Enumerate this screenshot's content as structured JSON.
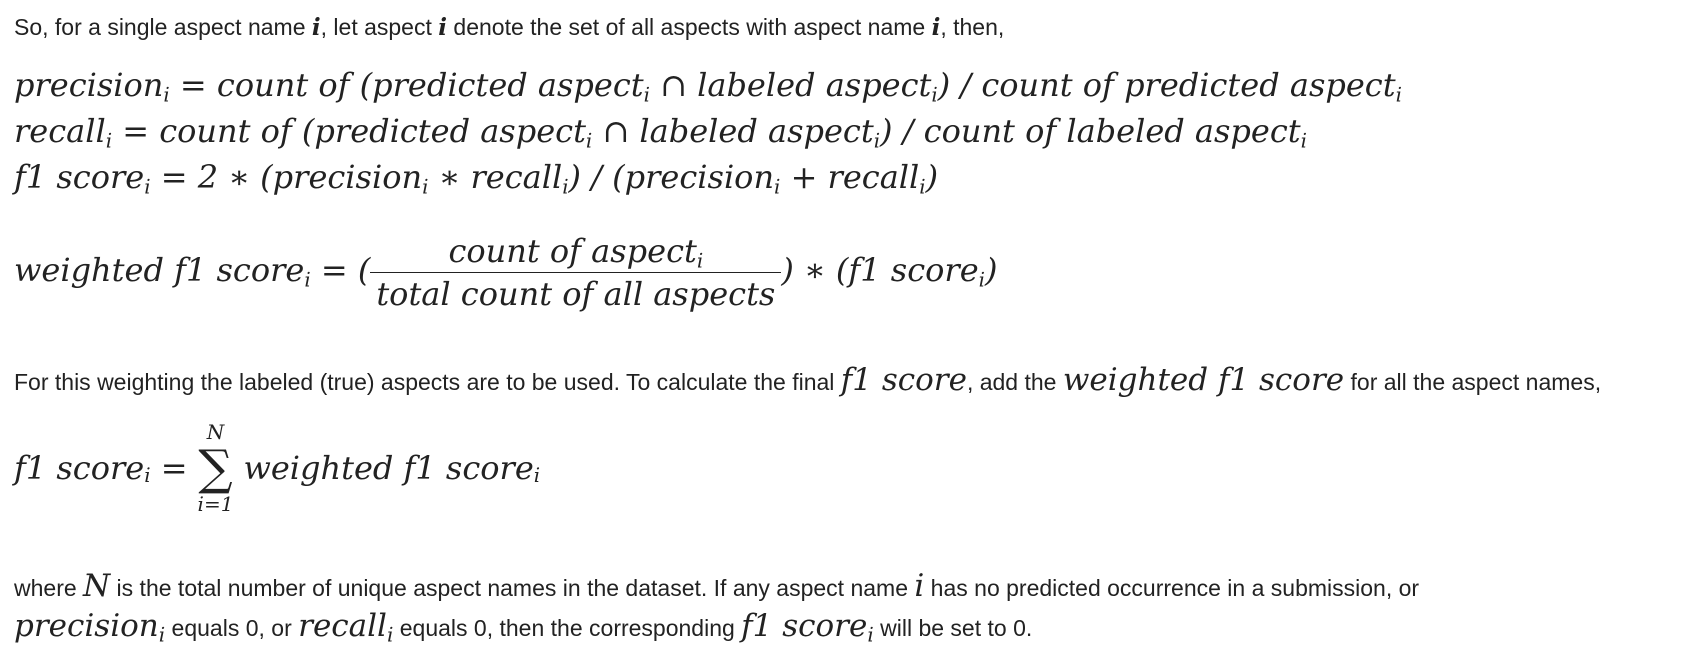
{
  "para1": {
    "a": "So, for a single aspect name ",
    "i1": "i",
    "b": ", let aspect ",
    "i2": "i",
    "c": " denote the set of all aspects with aspect name ",
    "i3": "i",
    "d": ", then,"
  },
  "eq_precision": {
    "lhs": "precision",
    "sub": "i",
    "rhs1": " = count of (predicted aspect",
    "rhs2": " ∩ labeled aspect",
    "rhs3": ") / count of predicted aspect"
  },
  "eq_recall": {
    "lhs": "recall",
    "sub": "i",
    "rhs1": " = count of (predicted aspect",
    "rhs2": " ∩ labeled aspect",
    "rhs3": ") / count of labeled aspect"
  },
  "eq_f1": {
    "lhs": "f1 score",
    "sub": "i",
    "rhs1": " = 2 ∗ (precision",
    "rhs2": " ∗ recall",
    "rhs3": ") / (precision",
    "rhs4": " + recall",
    "rhs5": ")"
  },
  "eq_weighted": {
    "lhs": "weighted f1 score",
    "sub": "i",
    "eq": " = (",
    "num": "count of aspect",
    "den": "total count of all aspects",
    "tail1": ") ∗ (f1 score",
    "tail2": ")"
  },
  "para2": {
    "a": "For this weighting the labeled (true) aspects are to be used. To calculate the final ",
    "m1": "f1 score",
    "b": ", add the ",
    "m2": "weighted f1 score",
    "c": " for all the aspect names,"
  },
  "eq_sum": {
    "lhs": "f1 score",
    "sub": "i",
    "eq": " =",
    "upper": "N",
    "sigma": "∑",
    "lower": "i=1",
    "body": "weighted f1 score"
  },
  "para3": {
    "a": "where ",
    "m1": "N",
    "b": " is the total number of unique aspect names in the dataset. If any aspect name ",
    "m2": "i",
    "c": " has no predicted occurrence in a submission, or"
  },
  "para4": {
    "m1": "precision",
    "m1sub": "i",
    "a": " equals 0, or ",
    "m2": "recall",
    "m2sub": "i",
    "b": " equals 0, then the corresponding ",
    "m3": "f1 score",
    "m3sub": "i",
    "c": " will be set to 0."
  }
}
